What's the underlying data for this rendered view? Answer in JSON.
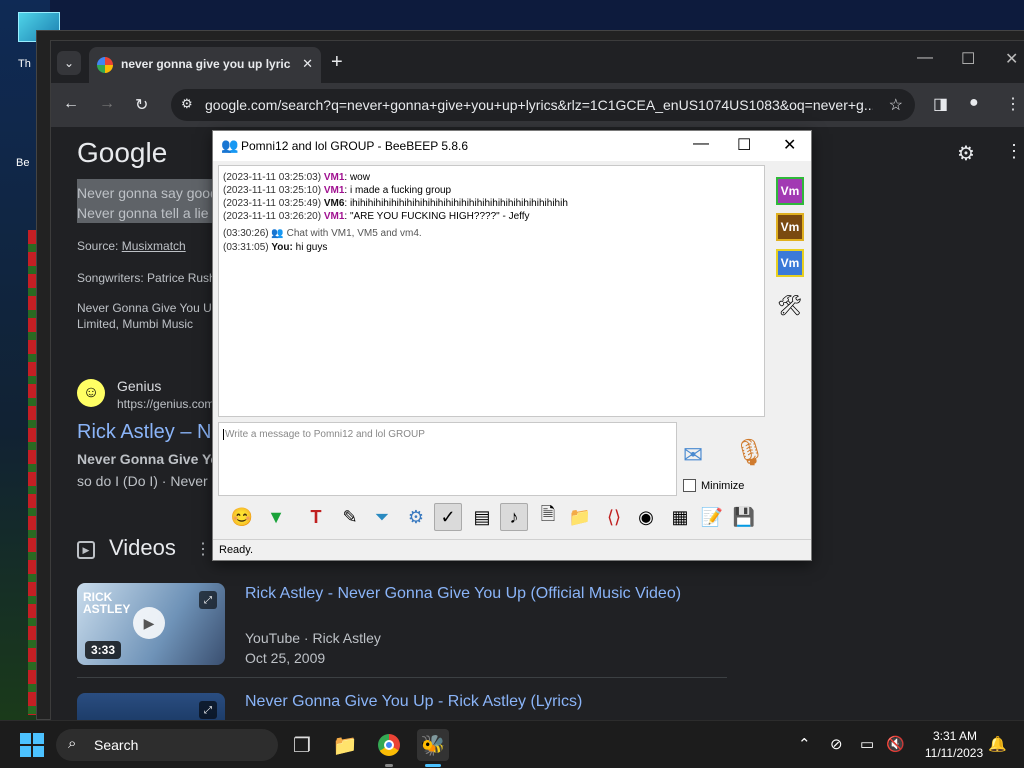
{
  "desktop": {
    "icon_label_1": "Th",
    "icon_label_2": "Be"
  },
  "browser": {
    "tab_title": "never gonna give you up lyrics",
    "url": "google.com/search?q=never+gonna+give+you+up+lyrics&rlz=1C1GCEA_enUS1074US1083&oq=never+g...",
    "google_logo": "Google",
    "lyric_1": "Never gonna say good",
    "lyric_2": "Never gonna tell a lie",
    "source_label": "Source: ",
    "source_link": "Musixmatch",
    "songwriters": "Songwriters: Patrice Rush",
    "publisher_1": "Never Gonna Give You U",
    "publisher_2": "Limited, Mumbi Music",
    "genius_name": "Genius",
    "genius_url": "https://genius.com",
    "genius_title": "Rick Astley – N",
    "genius_snip_bold": "Never Gonna Give Yo",
    "genius_snip": "so do I (Do I) · Never",
    "videos_heading": "Videos",
    "video_1": {
      "thumb_text": "RICK\nASTLEY",
      "duration": "3:33",
      "title": "Rick Astley - Never Gonna Give You Up (Official Music Video)",
      "source": "YouTube · Rick Astley",
      "date": "Oct 25, 2009"
    },
    "video_2": {
      "title": "Never Gonna Give You Up - Rick Astley (Lyrics)"
    }
  },
  "beebeep": {
    "title": "Pomni12 and lol GROUP - BeeBEEP 5.8.6",
    "messages": [
      {
        "ts": "(2023-11-11 03:25:03)",
        "name": "VM1",
        "text": " wow"
      },
      {
        "ts": "(2023-11-11 03:25:10)",
        "name": "VM1",
        "text": " i made a fucking group"
      },
      {
        "ts": "(2023-11-11 03:25:49)",
        "name": "VM6",
        "text": " ihihihihihihihihihihihihihihihihihihihihihihihihihihihih"
      },
      {
        "ts": "(2023-11-11 03:26:20)",
        "name": "VM1",
        "text": " \"ARE YOU FUCKING HIGH????\" - Jeffy"
      }
    ],
    "system_ts": "(03:30:26)",
    "system_text": "Chat with VM1, VM5 and vm4.",
    "you_ts": "(03:31:05)",
    "you_name": "You:",
    "you_text": " hi guys",
    "input_placeholder": "Write a message to Pomni12 and lol GROUP",
    "minimize_label": "Minimize",
    "status": "Ready.",
    "users": [
      {
        "label": "Vm",
        "color": "#a23ab3",
        "border": "#2fb83a"
      },
      {
        "label": "Vm",
        "color": "#7a4a10",
        "border": "#e0b020"
      },
      {
        "label": "Vm",
        "color": "#3b7ad8",
        "border": "#e8d020"
      }
    ]
  },
  "taskbar": {
    "search": "Search",
    "time": "3:31 AM",
    "date": "11/11/2023"
  }
}
